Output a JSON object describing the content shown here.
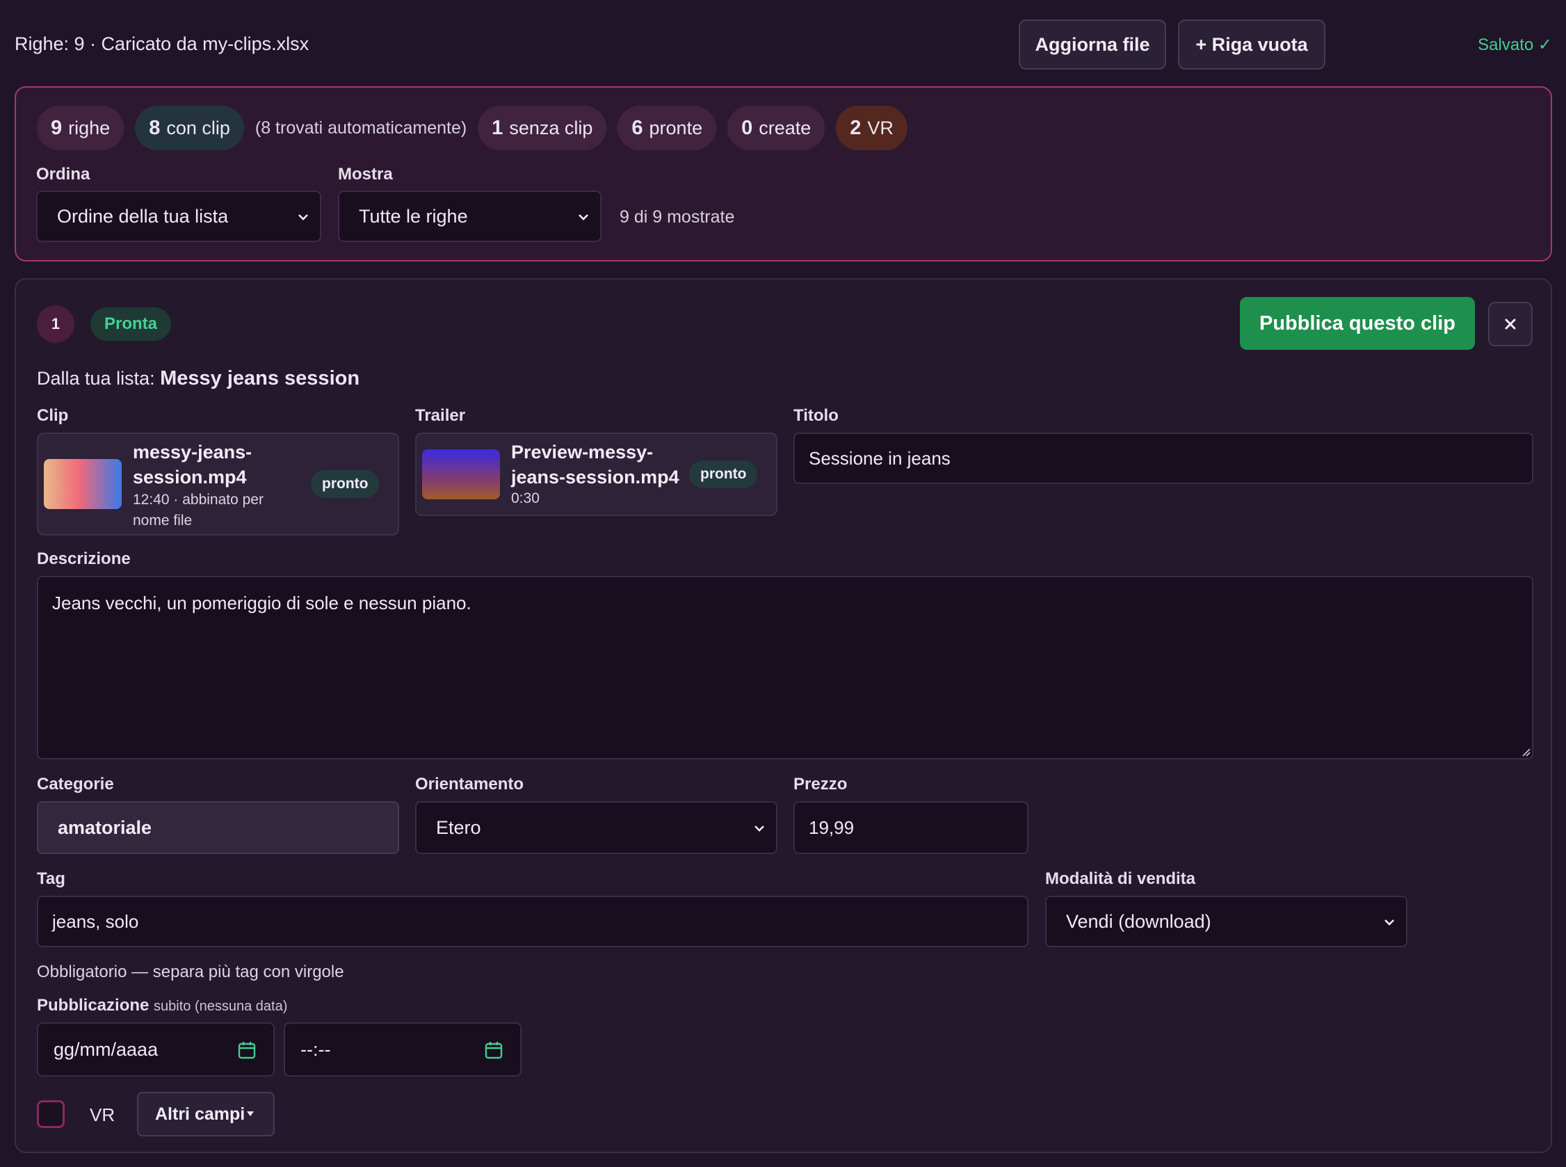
{
  "topbar": {
    "info": "Righe: 9 · Caricato da my-clips.xlsx",
    "refresh_label": "Aggiorna file",
    "empty_row_label": "+ Riga vuota",
    "saved_label": "Salvato ✓"
  },
  "summary": {
    "chips": {
      "rows": {
        "count": "9",
        "label": "righe"
      },
      "with_clip": {
        "count": "8",
        "label": "con clip"
      },
      "auto_found": "(8 trovati automaticamente)",
      "without_clip": {
        "count": "1",
        "label": "senza clip"
      },
      "ready": {
        "count": "6",
        "label": "pronte"
      },
      "created": {
        "count": "0",
        "label": "create"
      },
      "vr": {
        "count": "2",
        "label": "VR"
      }
    },
    "sort": {
      "label": "Ordina",
      "value": "Ordine della tua lista"
    },
    "show": {
      "label": "Mostra",
      "value": "Tutte le righe"
    },
    "shown_count": "9 di 9 mostrate"
  },
  "row": {
    "number": "1",
    "status": "Pronta",
    "publish_label": "Pubblica questo clip",
    "close_icon": "close-icon",
    "from_list_prefix": "Dalla tua lista:",
    "from_list_name": "Messy jeans session",
    "clip": {
      "label": "Clip",
      "name_line1": "messy-jeans-",
      "name_line2": "session.mp4",
      "meta_line1": "12:40 · abbinato per",
      "meta_line2": "nome file",
      "status": "pronto"
    },
    "trailer": {
      "label": "Trailer",
      "name_line1": "Preview-messy-",
      "name_line2": "jeans-session.mp4",
      "meta": "0:30",
      "status": "pronto"
    },
    "title": {
      "label": "Titolo",
      "value": "Sessione in jeans"
    },
    "description": {
      "label": "Descrizione",
      "value": "Jeans vecchi, un pomeriggio di sole e nessun piano."
    },
    "categories": {
      "label": "Categorie",
      "value": "amatoriale"
    },
    "orientation": {
      "label": "Orientamento",
      "value": "Etero"
    },
    "price": {
      "label": "Prezzo",
      "value": "19,99"
    },
    "tags": {
      "label": "Tag",
      "value": "jeans, solo",
      "hint": "Obbligatorio — separa più tag con virgole"
    },
    "sale_mode": {
      "label": "Modalità di vendita",
      "value": "Vendi (download)"
    },
    "publication": {
      "label": "Pubblicazione",
      "note": "subito (nessuna data)",
      "date_placeholder": "gg/mm/aaaa",
      "time_placeholder": "--:--"
    },
    "vr_label": "VR",
    "more_fields_label": "Altri campi"
  },
  "colors": {
    "background": "#201428",
    "accent_magenta": "#a3386f",
    "publish_green": "#1f8f4e",
    "saved_green": "#3fcf8e",
    "ready_green": "#44d193"
  }
}
